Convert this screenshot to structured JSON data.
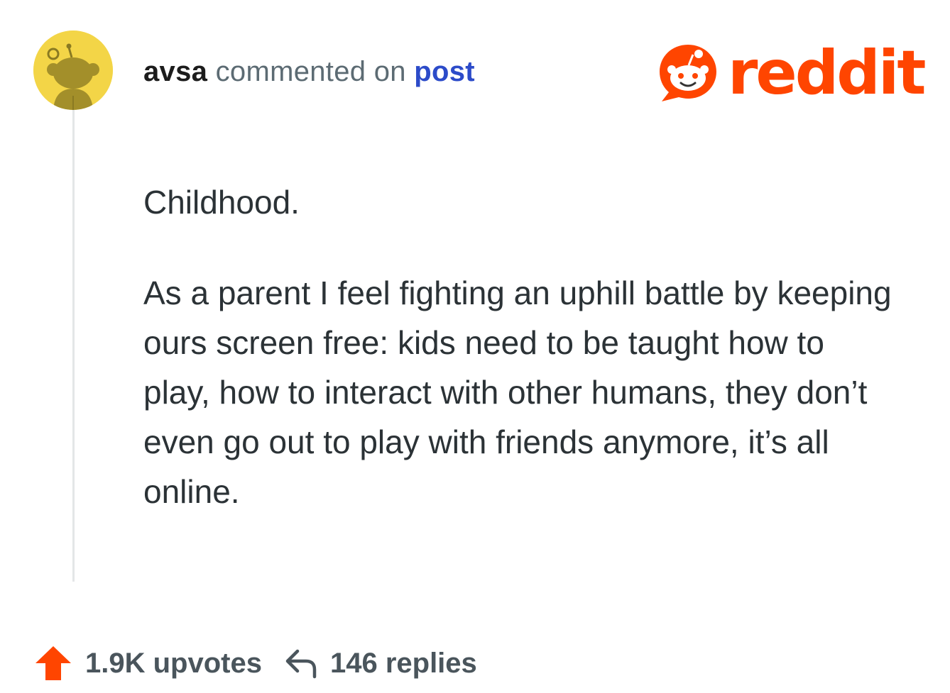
{
  "comment": {
    "username": "avsa",
    "action": "commented on",
    "post_link": "post",
    "paragraphs": [
      "Childhood.",
      "As a parent I feel fighting an uphill battle by keeping ours screen free: kids need to be taught how to play, how to interact with other humans, they don’t even go out to play with friends anymore, it’s all online."
    ]
  },
  "brand": {
    "wordmark": "reddit",
    "color": "#ff4500"
  },
  "avatar": {
    "background": "#f3d547",
    "icon": "snoo-avatar-icon"
  },
  "stats": {
    "upvotes": "1.9K upvotes",
    "replies": "146 replies",
    "upvote_icon": "upvote-arrow-icon",
    "reply_icon": "reply-arrow-icon",
    "upvote_color": "#ff4500"
  }
}
